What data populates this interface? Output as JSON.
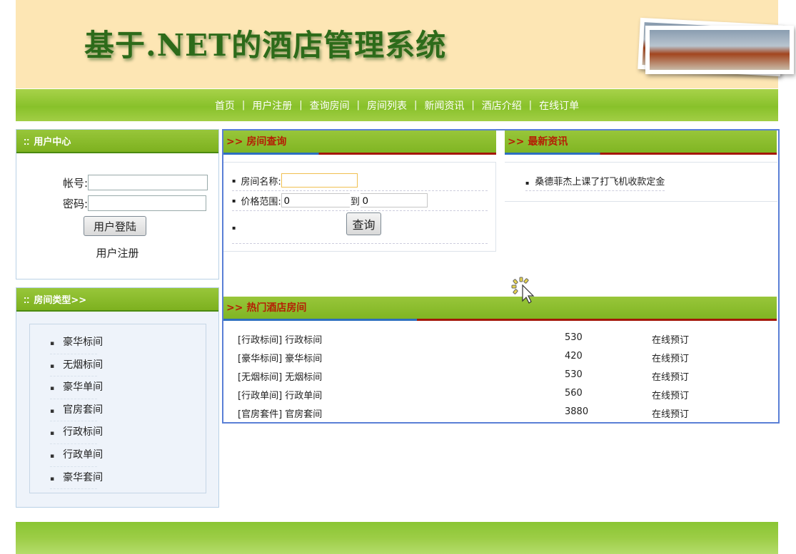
{
  "header": {
    "site_title": "基于.NET的酒店管理系统"
  },
  "nav": {
    "items": [
      "首页",
      "用户注册",
      "查询房间",
      "房间列表",
      "新闻资讯",
      "酒店介绍",
      "在线订单"
    ],
    "separator": "|"
  },
  "user_center": {
    "title": "用户中心",
    "account_label": "帐号:",
    "account_value": "",
    "password_label": "密码:",
    "password_value": "",
    "login_button": "用户登陆",
    "register_link": "用户注册"
  },
  "room_types": {
    "title": "房间类型>>",
    "items": [
      "豪华标间",
      "无烟标间",
      "豪华单间",
      "官房套间",
      "行政标间",
      "行政单间",
      "豪华套间"
    ]
  },
  "room_search": {
    "title": ">> 房间查询",
    "name_label": "房间名称:",
    "name_value": "",
    "price_label": "价格范围:",
    "price_from": "0",
    "price_to_label": "到",
    "price_to": "0",
    "search_button": "查询"
  },
  "latest_news": {
    "title": ">> 最新资讯",
    "items": [
      "桑德菲杰上课了打飞机收款定金"
    ]
  },
  "hot_rooms": {
    "title": ">> 热门酒店房间",
    "rows": [
      {
        "name": "[行政标间] 行政标间",
        "price": "530",
        "action": "在线预订"
      },
      {
        "name": "[豪华标间] 豪华标间",
        "price": "420",
        "action": "在线预订"
      },
      {
        "name": "[无烟标间] 无烟标间",
        "price": "530",
        "action": "在线预订"
      },
      {
        "name": "[行政单间] 行政单间",
        "price": "560",
        "action": "在线预订"
      },
      {
        "name": "[官房套件] 官房套间",
        "price": "3880",
        "action": "在线预订"
      }
    ]
  },
  "colors": {
    "nav_green": "#8fc537",
    "header_bg": "#fde6b4",
    "title_green": "#2d6b1a",
    "panel_title_red": "#b41e05",
    "main_border_blue": "#5a7fd6"
  }
}
